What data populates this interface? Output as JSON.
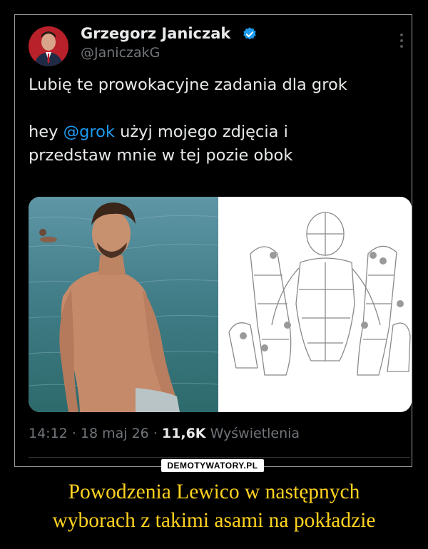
{
  "post": {
    "author_name": "Grzegorz Janiczak",
    "author_handle": "@JaniczakG",
    "text_line1": "Lubię te prowokacyjne zadania dla grok",
    "text_hey": "hey ",
    "text_mention": "@grok",
    "text_line2_rest": " użyj mojego zdjęcia i",
    "text_line3": "przedstaw mnie w tej pozie obok",
    "time": "14:12",
    "date": "18 maj 26",
    "views_count": "11,6K",
    "views_label": "Wyświetlenia",
    "separator": "·",
    "icons": [
      "verified-icon",
      "more-options-icon"
    ],
    "colors": {
      "mention": "#1d9bf0",
      "verified": "#1d9bf0"
    }
  },
  "watermark": {
    "logo_text": "DEMOTYWATORY.PL"
  },
  "caption": {
    "line1": "Powodzenia Lewico w następnych",
    "line2": "wyborach z takimi asami na pokładzie",
    "color": "#ffd21f"
  }
}
